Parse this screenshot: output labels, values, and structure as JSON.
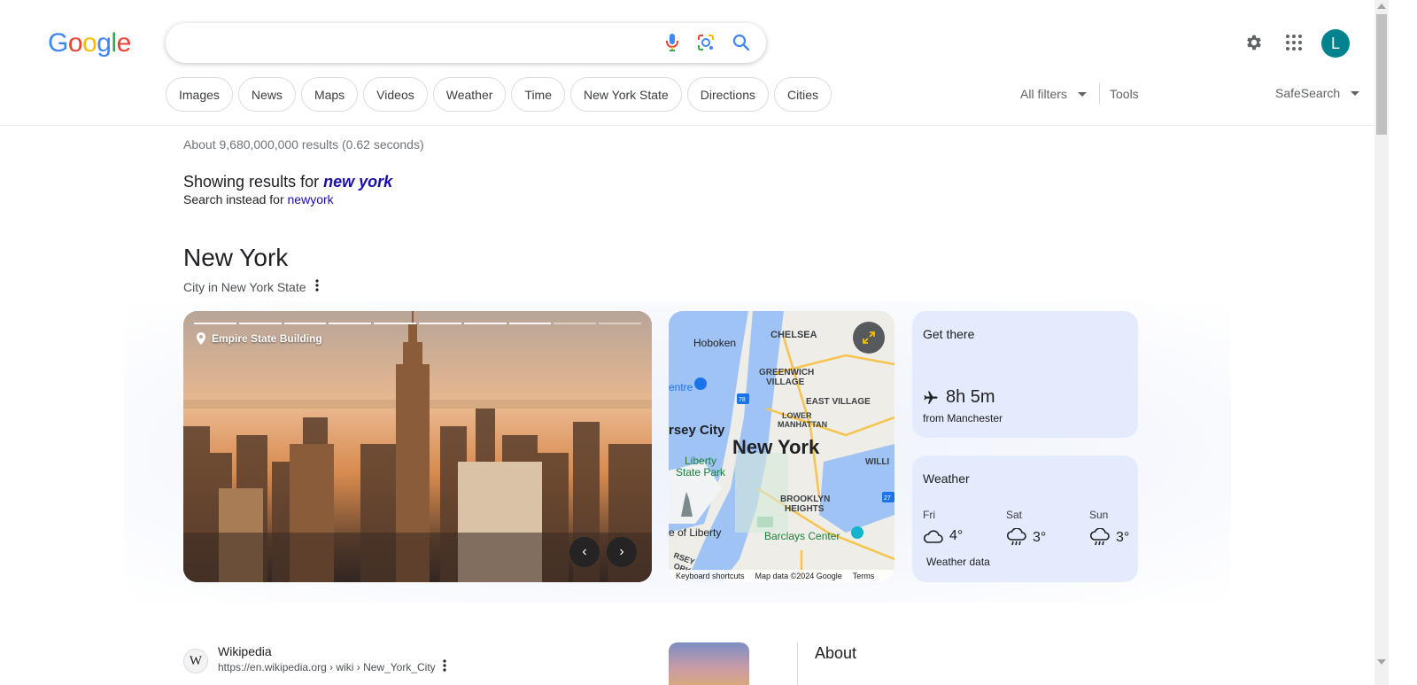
{
  "logo": {
    "letters": [
      "G",
      "o",
      "o",
      "g",
      "l",
      "e"
    ],
    "colors": [
      "#4285F4",
      "#EA4335",
      "#FBBC05",
      "#4285F4",
      "#34A853",
      "#EA4335"
    ]
  },
  "search": {
    "value": "",
    "placeholder": ""
  },
  "header": {
    "avatar_letter": "L",
    "avatar_color": "#00838f"
  },
  "chips": [
    "Images",
    "News",
    "Maps",
    "Videos",
    "Weather",
    "Time",
    "New York State",
    "Directions",
    "Cities"
  ],
  "filters": {
    "all_filters": "All filters",
    "tools": "Tools",
    "safesearch": "SafeSearch"
  },
  "results": {
    "stats": "About 9,680,000,000 results (0.62 seconds)",
    "showing_prefix": "Showing results for",
    "showing_query": "new york",
    "instead_prefix": "Search instead for",
    "instead_query": "newyork"
  },
  "knowledge_panel": {
    "title": "New York",
    "subtitle": "City in New York State",
    "photo_label": "Empire State Building",
    "map": {
      "labels": {
        "hoboken": "Hoboken",
        "chelsea": "CHELSEA",
        "greenwich": "GREENWICH",
        "village": "VILLAGE",
        "east_village": "EAST VILLAGE",
        "lower": "LOWER",
        "manhattan": "MANHATTAN",
        "jersey_city": "rsey City",
        "new_york": "New York",
        "liberty": "Liberty",
        "state_park": "State Park",
        "of_liberty": "e of Liberty",
        "brooklyn": "BROOKLYN",
        "heights": "HEIGHTS",
        "barclays": "Barclays Center",
        "willi": "WILLI",
        "centre": "entre",
        "rsey": "RSEY",
        "ork": "ORK",
        "shield_78": "78",
        "shield_27": "27"
      },
      "footer": {
        "shortcuts": "Keyboard shortcuts",
        "data": "Map data ©2024 Google",
        "terms": "Terms"
      }
    },
    "get_there": {
      "title": "Get there",
      "time": "8h 5m",
      "from": "from Manchester"
    },
    "weather": {
      "title": "Weather",
      "days": [
        {
          "day": "Fri",
          "temp": "4°",
          "icon": "cloud-icon"
        },
        {
          "day": "Sat",
          "temp": "3°",
          "icon": "rain-icon"
        },
        {
          "day": "Sun",
          "temp": "3°",
          "icon": "rain-icon"
        }
      ],
      "footer": "Weather data"
    }
  },
  "wiki": {
    "icon_letter": "W",
    "name": "Wikipedia",
    "url": "https://en.wikipedia.org › wiki › New_York_City"
  },
  "about": {
    "heading": "About"
  }
}
